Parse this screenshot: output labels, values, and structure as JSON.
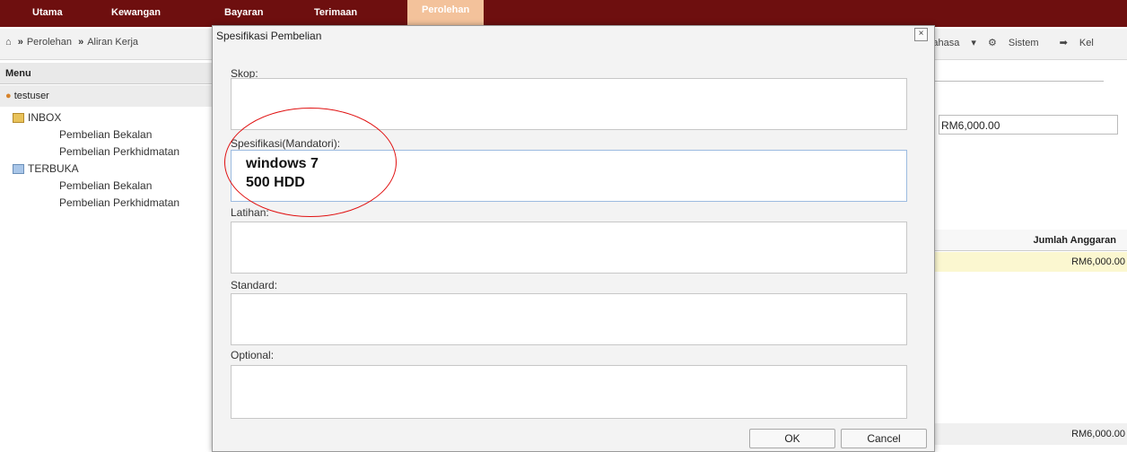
{
  "topbar": {
    "tabs": [
      "Utama",
      "Kewangan",
      "Bayaran",
      "Terimaan",
      "Perolehan"
    ]
  },
  "toolbar": {
    "crumb_1": "Perolehan",
    "crumb_2": "Aliran Kerja",
    "bahasa": "Bahasa",
    "sistem": "Sistem",
    "keluar": "Kel"
  },
  "menu": {
    "title": "Menu",
    "user": "testuser",
    "inbox": "INBOX",
    "inbox_items": [
      "Pembelian Bekalan",
      "Pembelian Perkhidmatan"
    ],
    "terbuka": "TERBUKA",
    "terbuka_items": [
      "Pembelian Bekalan",
      "Pembelian Perkhidmatan"
    ]
  },
  "background_panel": {
    "field_value": "RM6,000.00",
    "column_header": "Jumlah Anggaran",
    "row_value": "RM6,000.00",
    "total_value": "RM6,000.00"
  },
  "dialog": {
    "title": "Spesifikasi Pembelian",
    "close": "×",
    "sections": {
      "skop": {
        "label": "Skop:",
        "value": ""
      },
      "spesifikasi": {
        "label": "Spesifikasi(Mandatori):",
        "value": "windows 7\n500 HDD"
      },
      "latihan": {
        "label": "Latihan:",
        "value": ""
      },
      "standard": {
        "label": "Standard:",
        "value": ""
      },
      "optional": {
        "label": "Optional:",
        "value": ""
      }
    },
    "ok_label": "OK",
    "cancel_label": "Cancel"
  },
  "colors": {
    "topbar": "#6e0f0f",
    "active_tab": "#f3c29b",
    "annotation": "#e01010",
    "highlight_row": "#fbf7d0"
  }
}
